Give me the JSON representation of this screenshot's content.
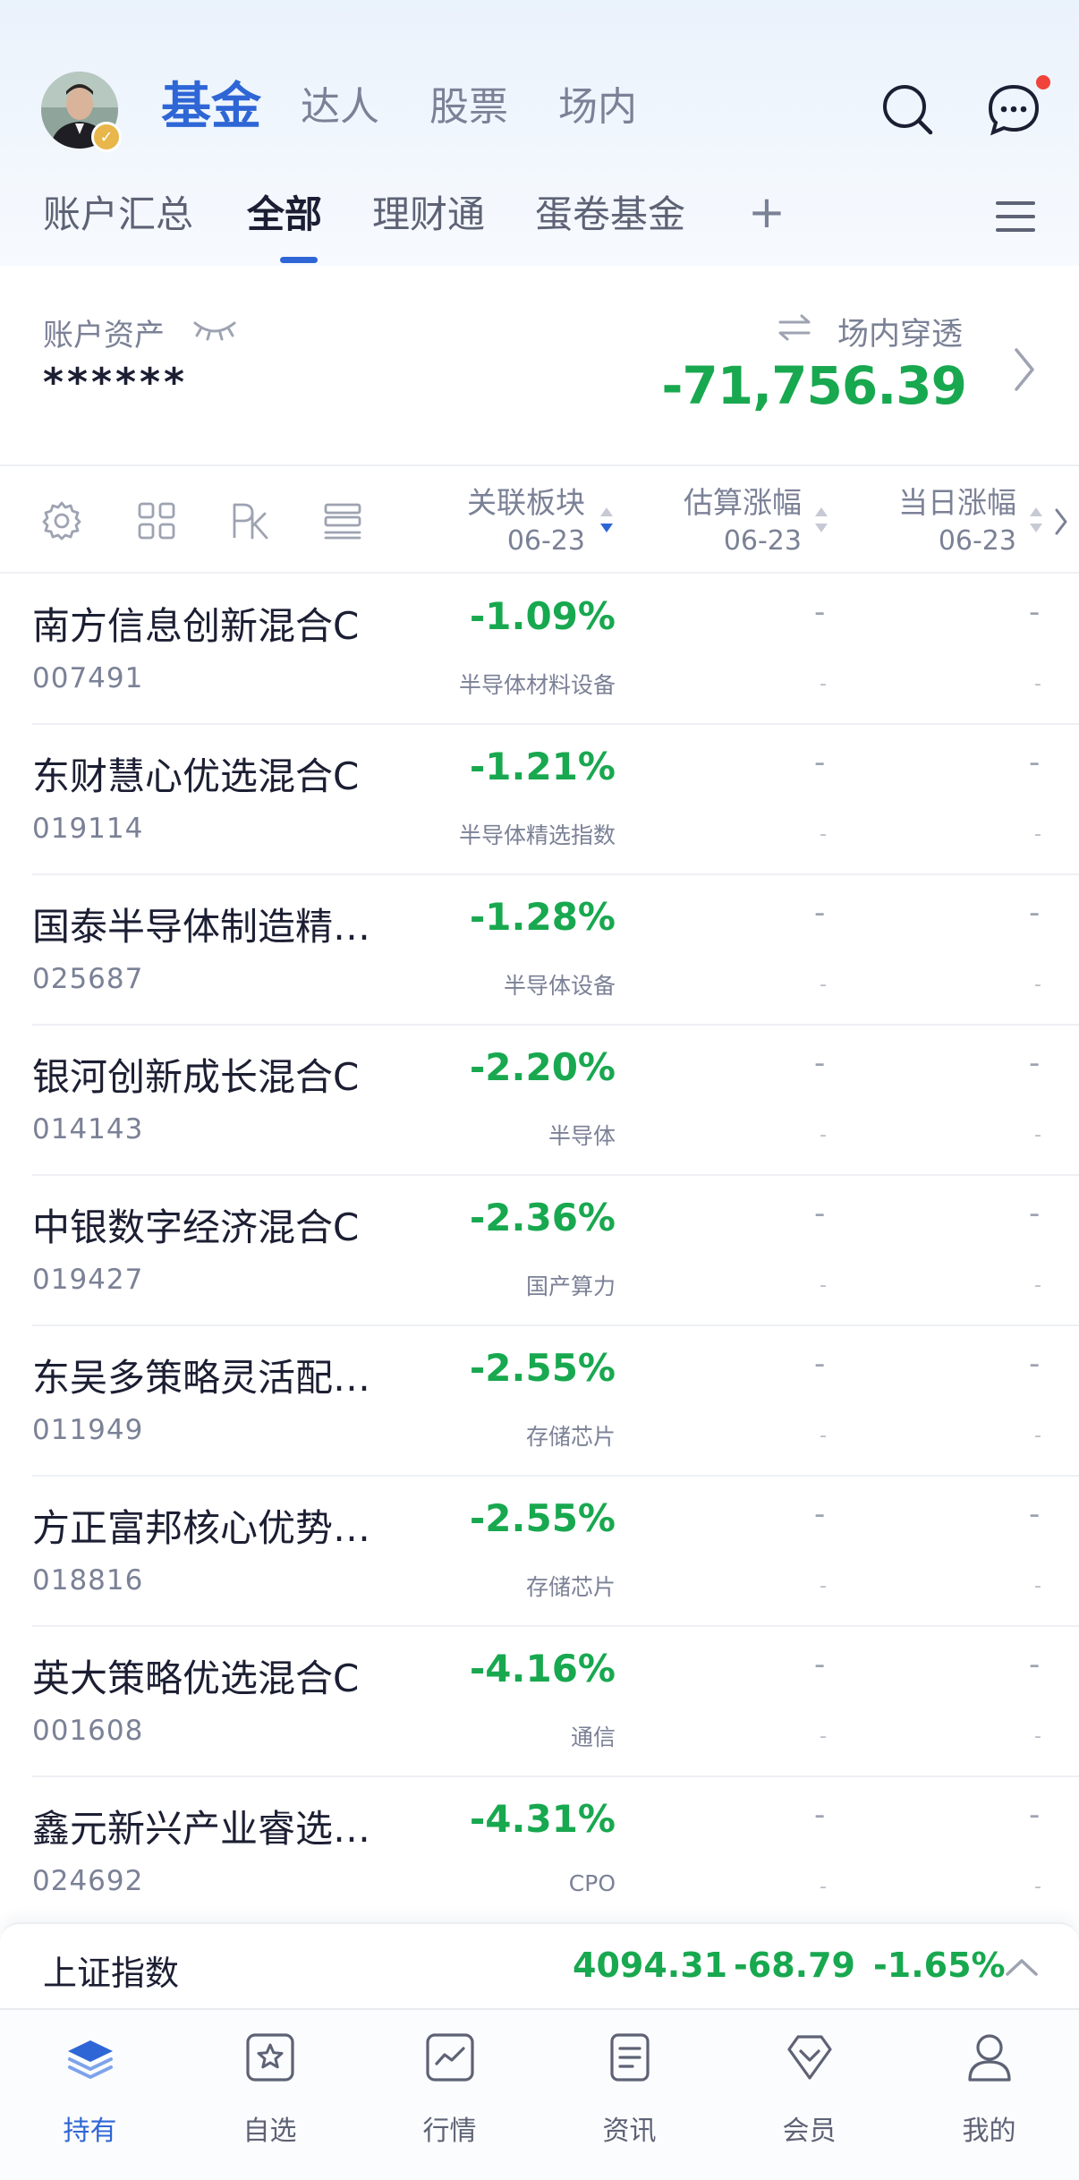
{
  "header": {
    "tabs": [
      "基金",
      "达人",
      "股票",
      "场内"
    ],
    "sub_tabs": [
      "账户汇总",
      "全部",
      "理财通",
      "蛋卷基金"
    ],
    "add_label": "+"
  },
  "assets": {
    "label": "账户资产",
    "masked_value": "******",
    "penetration_label": "场内穿透",
    "penetration_value": "-71,756.39"
  },
  "columns": {
    "sector": {
      "title": "关联板块",
      "date": "06-23"
    },
    "estimate": {
      "title": "估算涨幅",
      "date": "06-23"
    },
    "daily": {
      "title": "当日涨幅",
      "date": "06-23"
    }
  },
  "funds": [
    {
      "name": "南方信息创新混合C",
      "code": "007491",
      "change": "-1.09%",
      "sector": "半导体材料设备",
      "est": "-",
      "est_sub": "-",
      "day": "-",
      "day_sub": "-"
    },
    {
      "name": "东财慧心优选混合C",
      "code": "019114",
      "change": "-1.21%",
      "sector": "半导体精选指数",
      "est": "-",
      "est_sub": "-",
      "day": "-",
      "day_sub": "-"
    },
    {
      "name": "国泰半导体制造精…",
      "code": "025687",
      "change": "-1.28%",
      "sector": "半导体设备",
      "est": "-",
      "est_sub": "-",
      "day": "-",
      "day_sub": "-"
    },
    {
      "name": "银河创新成长混合C",
      "code": "014143",
      "change": "-2.20%",
      "sector": "半导体",
      "est": "-",
      "est_sub": "-",
      "day": "-",
      "day_sub": "-"
    },
    {
      "name": "中银数字经济混合C",
      "code": "019427",
      "change": "-2.36%",
      "sector": "国产算力",
      "est": "-",
      "est_sub": "-",
      "day": "-",
      "day_sub": "-"
    },
    {
      "name": "东吴多策略灵活配…",
      "code": "011949",
      "change": "-2.55%",
      "sector": "存储芯片",
      "est": "-",
      "est_sub": "-",
      "day": "-",
      "day_sub": "-"
    },
    {
      "name": "方正富邦核心优势…",
      "code": "018816",
      "change": "-2.55%",
      "sector": "存储芯片",
      "est": "-",
      "est_sub": "-",
      "day": "-",
      "day_sub": "-"
    },
    {
      "name": "英大策略优选混合C",
      "code": "001608",
      "change": "-4.16%",
      "sector": "通信",
      "est": "-",
      "est_sub": "-",
      "day": "-",
      "day_sub": "-"
    },
    {
      "name": "鑫元新兴产业睿选…",
      "code": "024692",
      "change": "-4.31%",
      "sector": "CPO",
      "est": "-",
      "est_sub": "-",
      "day": "-",
      "day_sub": "-"
    }
  ],
  "index": {
    "name": "上证指数",
    "value": "4094.31",
    "change": "-68.79",
    "percent": "-1.65%"
  },
  "nav": [
    "持有",
    "自选",
    "行情",
    "资讯",
    "会员",
    "我的"
  ],
  "colors": {
    "accent": "#2e66d6",
    "down": "#18a84f",
    "notification": "#f0443a"
  }
}
